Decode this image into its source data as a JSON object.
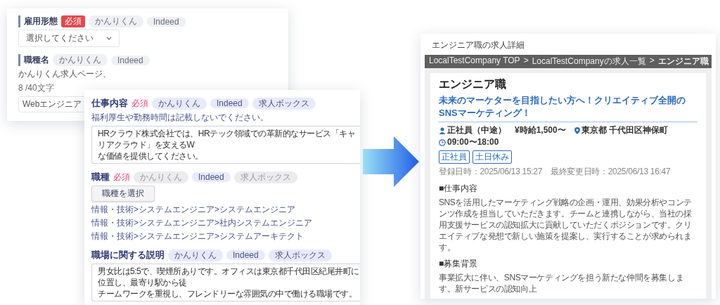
{
  "form_back": {
    "label_bar": true,
    "fields": [
      {
        "kind": "select",
        "label": "雇用形態",
        "required": "必須",
        "tags": [
          "かんりくん",
          "Indeed"
        ],
        "value": "選択してください"
      },
      {
        "kind": "text",
        "label": "職種名",
        "tags": [
          "かんりくん",
          "Indeed"
        ],
        "hint": "かんりくん求人ページ、",
        "count": "8 /40文字",
        "value": "Webエンジニア"
      }
    ]
  },
  "form_front": {
    "label_bar": false,
    "fields": [
      {
        "kind": "textarea",
        "label": "仕事内容",
        "required": "必須",
        "tags": [
          {
            "text": "かんりくん",
            "disabled": false
          },
          {
            "text": "Indeed",
            "disabled": false
          },
          {
            "text": "求人ボックス",
            "disabled": false
          }
        ],
        "hint": "福利厚生や勤務時間は記載しないでください。",
        "lines": [
          "HRクラウド株式会社では、HRテック領域での革新的なサービス「キャリアクラウド」を支えるW",
          "な価値を提供してください。"
        ]
      },
      {
        "kind": "picker",
        "label": "職種",
        "required": "必須",
        "tags": [
          {
            "text": "かんりくん",
            "disabled": true
          },
          {
            "text": "Indeed",
            "disabled": false
          },
          {
            "text": "求人ボックス",
            "disabled": true
          }
        ],
        "button": "職種を選択",
        "items": [
          "情報・技術>システムエンジニア>システムエンジニア",
          "情報・技術>システムエンジニア>社内システムエンジニア",
          "情報・技術>システムエンジニア>システムアーキテクト"
        ]
      },
      {
        "kind": "textarea",
        "label": "職場に関する説明",
        "tags": [
          {
            "text": "かんりくん",
            "disabled": false
          },
          {
            "text": "Indeed",
            "disabled": false
          },
          {
            "text": "求人ボックス",
            "disabled": false
          }
        ],
        "lines": [
          "男女比は5:5で、喫煙所ありです。オフィスは東京都千代田区紀尾井町に位置し、最寄り駅から徒",
          "チームワークを重視し、フレンドリーな雰囲気の中で働ける職場です。"
        ]
      }
    ]
  },
  "job_detail": {
    "page_title": "エンジニア職の求人詳細",
    "breadcrumb": [
      {
        "kind": "link",
        "text": "LocalTestCompany TOP"
      },
      {
        "kind": "separator",
        "text": ">"
      },
      {
        "kind": "link",
        "text": "LocalTestCompanyの求人一覧"
      },
      {
        "kind": "separator",
        "text": ">"
      },
      {
        "kind": "current",
        "text": "エンジニア職"
      }
    ],
    "title": "エンジニア職",
    "catch": "未来のマーケターを目指したい方へ！クリエイティブ全開のSNSマーケティング！",
    "meta": [
      {
        "kind": "person",
        "text": "正社員（中途）"
      },
      {
        "kind": "plain",
        "text": "¥時給1,500〜"
      },
      {
        "kind": "pin",
        "text": "東京都 千代田区神保町"
      },
      {
        "kind": "clock",
        "text": "09:00〜18:00"
      }
    ],
    "tags": [
      "正社員",
      "土日休み"
    ],
    "dates": "登録日時：2025/06/13 15:27　最終変更日時：2025/06/13 16:47",
    "sections": [
      {
        "heading": "■仕事内容",
        "body": "SNSを活用したマーケティング戦略の企画・運用、効果分析やコンテンツ作成を担当していただきます。チームと連携しながら、当社の採用支援サービスの認知拡大に貢献していただくポジションです。クリエイティブな発想で新しい施策を提案し、実行することが求められます。"
      },
      {
        "heading": "■募集背景",
        "body": "事業拡大に伴い、SNSマーケティングを担う新たな仲間を募集します。新サービスの認知向上"
      }
    ]
  }
}
